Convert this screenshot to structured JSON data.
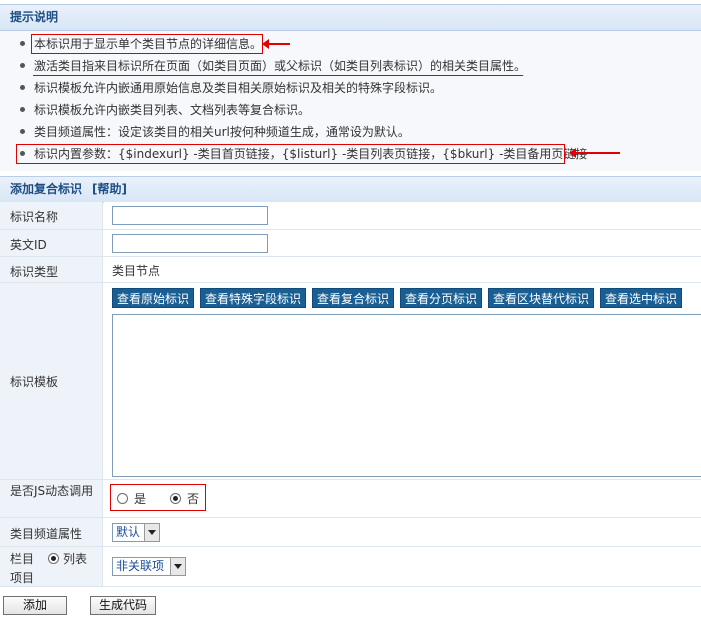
{
  "tips_section": {
    "title": "提示说明",
    "items": [
      "本标识用于显示单个类目节点的详细信息。",
      "激活类目指来目标识所在页面（如类目页面）或父标识（如类目列表标识）的相关类目属性。",
      "标识模板允许内嵌通用原始信息及类目相关原始标识及相关的特殊字段标识。",
      "标识模板允许内嵌类目列表、文档列表等复合标识。",
      "类目频道属性：设定该类目的相关url按何种频道生成，通常设为默认。",
      "标识内置参数：{$indexurl} -类目首页链接，{$listurl} -类目列表页链接，{$bkurl} -类目备用页链接"
    ]
  },
  "form_section": {
    "title": "添加复合标识",
    "help_link": "[帮助]"
  },
  "fields": {
    "name_label": "标识名称",
    "name_value": "",
    "ename_label": "英文ID",
    "ename_value": "",
    "type_label": "标识类型",
    "type_value": "类目节点",
    "template_label": "标识模板",
    "template_buttons": [
      "查看原始标识",
      "查看特殊字段标识",
      "查看复合标识",
      "查看分页标识",
      "查看区块替代标识",
      "查看选中标识"
    ],
    "js_label": "是否JS动态调用",
    "js_yes": "是",
    "js_no": "否",
    "js_selected": "否",
    "channel_label": "类目频道属性",
    "channel_value": "默认",
    "item_label_a": "栏目",
    "item_label_b": "列表",
    "item_label_c": "项目",
    "item_select": "非关联项"
  },
  "actions": {
    "add": "添加",
    "generate": "生成代码"
  },
  "colors": {
    "header_text": "#1d4f85",
    "button_bg": "#1a5f94",
    "annotation_red": "#e00000"
  }
}
